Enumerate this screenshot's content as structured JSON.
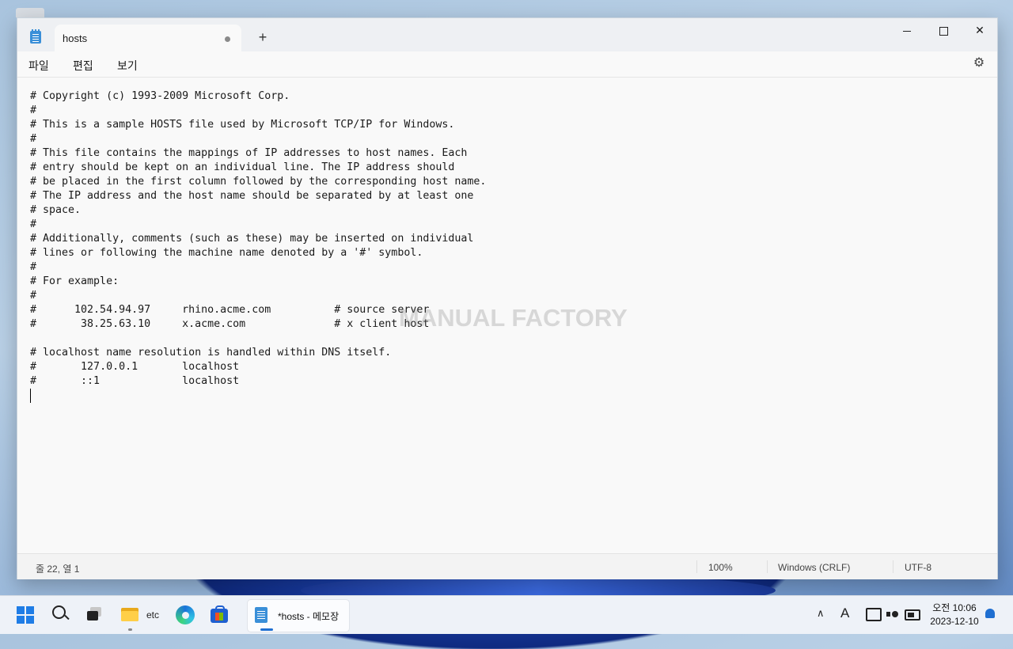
{
  "window": {
    "tab_title": "hosts",
    "new_tab_symbol": "+",
    "close_symbol": "✕"
  },
  "menu": {
    "file": "파일",
    "edit": "편집",
    "view": "보기"
  },
  "editor": {
    "content": "# Copyright (c) 1993-2009 Microsoft Corp.\n#\n# This is a sample HOSTS file used by Microsoft TCP/IP for Windows.\n#\n# This file contains the mappings of IP addresses to host names. Each\n# entry should be kept on an individual line. The IP address should\n# be placed in the first column followed by the corresponding host name.\n# The IP address and the host name should be separated by at least one\n# space.\n#\n# Additionally, comments (such as these) may be inserted on individual\n# lines or following the machine name denoted by a '#' symbol.\n#\n# For example:\n#\n#      102.54.94.97     rhino.acme.com          # source server\n#       38.25.63.10     x.acme.com              # x client host\n\n# localhost name resolution is handled within DNS itself.\n#\t127.0.0.1       localhost\n#\t::1             localhost\n",
    "watermark": "MANUAL FACTORY"
  },
  "status": {
    "position": "줄 22, 열 1",
    "zoom": "100%",
    "line_ending": "Windows (CRLF)",
    "encoding": "UTF-8"
  },
  "taskbar": {
    "folder_label": "etc",
    "notepad_label": "*hosts - 메모장",
    "tray_font": "A",
    "tray_chevron": "∧",
    "clock_time": "오전 10:06",
    "clock_date": "2023-12-10"
  },
  "colors": {
    "accent": "#1f6fd1",
    "notepad_icon": "#3a8fd8"
  }
}
